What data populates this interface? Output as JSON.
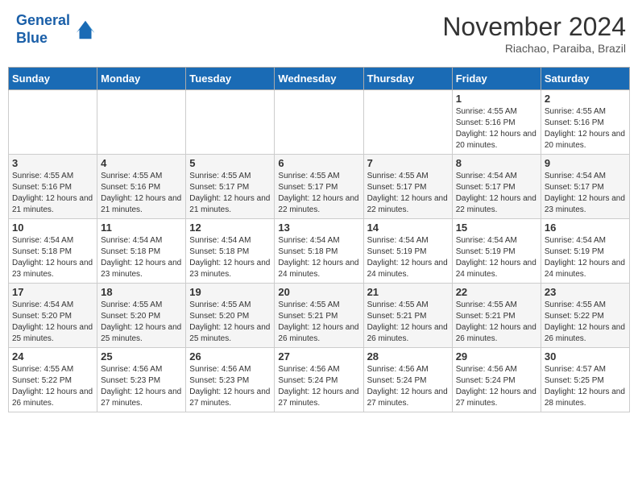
{
  "header": {
    "logo_line1": "General",
    "logo_line2": "Blue",
    "month_title": "November 2024",
    "subtitle": "Riachao, Paraiba, Brazil"
  },
  "days_of_week": [
    "Sunday",
    "Monday",
    "Tuesday",
    "Wednesday",
    "Thursday",
    "Friday",
    "Saturday"
  ],
  "weeks": [
    [
      {
        "day": "",
        "info": ""
      },
      {
        "day": "",
        "info": ""
      },
      {
        "day": "",
        "info": ""
      },
      {
        "day": "",
        "info": ""
      },
      {
        "day": "",
        "info": ""
      },
      {
        "day": "1",
        "info": "Sunrise: 4:55 AM\nSunset: 5:16 PM\nDaylight: 12 hours and 20 minutes."
      },
      {
        "day": "2",
        "info": "Sunrise: 4:55 AM\nSunset: 5:16 PM\nDaylight: 12 hours and 20 minutes."
      }
    ],
    [
      {
        "day": "3",
        "info": "Sunrise: 4:55 AM\nSunset: 5:16 PM\nDaylight: 12 hours and 21 minutes."
      },
      {
        "day": "4",
        "info": "Sunrise: 4:55 AM\nSunset: 5:16 PM\nDaylight: 12 hours and 21 minutes."
      },
      {
        "day": "5",
        "info": "Sunrise: 4:55 AM\nSunset: 5:17 PM\nDaylight: 12 hours and 21 minutes."
      },
      {
        "day": "6",
        "info": "Sunrise: 4:55 AM\nSunset: 5:17 PM\nDaylight: 12 hours and 22 minutes."
      },
      {
        "day": "7",
        "info": "Sunrise: 4:55 AM\nSunset: 5:17 PM\nDaylight: 12 hours and 22 minutes."
      },
      {
        "day": "8",
        "info": "Sunrise: 4:54 AM\nSunset: 5:17 PM\nDaylight: 12 hours and 22 minutes."
      },
      {
        "day": "9",
        "info": "Sunrise: 4:54 AM\nSunset: 5:17 PM\nDaylight: 12 hours and 23 minutes."
      }
    ],
    [
      {
        "day": "10",
        "info": "Sunrise: 4:54 AM\nSunset: 5:18 PM\nDaylight: 12 hours and 23 minutes."
      },
      {
        "day": "11",
        "info": "Sunrise: 4:54 AM\nSunset: 5:18 PM\nDaylight: 12 hours and 23 minutes."
      },
      {
        "day": "12",
        "info": "Sunrise: 4:54 AM\nSunset: 5:18 PM\nDaylight: 12 hours and 23 minutes."
      },
      {
        "day": "13",
        "info": "Sunrise: 4:54 AM\nSunset: 5:18 PM\nDaylight: 12 hours and 24 minutes."
      },
      {
        "day": "14",
        "info": "Sunrise: 4:54 AM\nSunset: 5:19 PM\nDaylight: 12 hours and 24 minutes."
      },
      {
        "day": "15",
        "info": "Sunrise: 4:54 AM\nSunset: 5:19 PM\nDaylight: 12 hours and 24 minutes."
      },
      {
        "day": "16",
        "info": "Sunrise: 4:54 AM\nSunset: 5:19 PM\nDaylight: 12 hours and 24 minutes."
      }
    ],
    [
      {
        "day": "17",
        "info": "Sunrise: 4:54 AM\nSunset: 5:20 PM\nDaylight: 12 hours and 25 minutes."
      },
      {
        "day": "18",
        "info": "Sunrise: 4:55 AM\nSunset: 5:20 PM\nDaylight: 12 hours and 25 minutes."
      },
      {
        "day": "19",
        "info": "Sunrise: 4:55 AM\nSunset: 5:20 PM\nDaylight: 12 hours and 25 minutes."
      },
      {
        "day": "20",
        "info": "Sunrise: 4:55 AM\nSunset: 5:21 PM\nDaylight: 12 hours and 26 minutes."
      },
      {
        "day": "21",
        "info": "Sunrise: 4:55 AM\nSunset: 5:21 PM\nDaylight: 12 hours and 26 minutes."
      },
      {
        "day": "22",
        "info": "Sunrise: 4:55 AM\nSunset: 5:21 PM\nDaylight: 12 hours and 26 minutes."
      },
      {
        "day": "23",
        "info": "Sunrise: 4:55 AM\nSunset: 5:22 PM\nDaylight: 12 hours and 26 minutes."
      }
    ],
    [
      {
        "day": "24",
        "info": "Sunrise: 4:55 AM\nSunset: 5:22 PM\nDaylight: 12 hours and 26 minutes."
      },
      {
        "day": "25",
        "info": "Sunrise: 4:56 AM\nSunset: 5:23 PM\nDaylight: 12 hours and 27 minutes."
      },
      {
        "day": "26",
        "info": "Sunrise: 4:56 AM\nSunset: 5:23 PM\nDaylight: 12 hours and 27 minutes."
      },
      {
        "day": "27",
        "info": "Sunrise: 4:56 AM\nSunset: 5:24 PM\nDaylight: 12 hours and 27 minutes."
      },
      {
        "day": "28",
        "info": "Sunrise: 4:56 AM\nSunset: 5:24 PM\nDaylight: 12 hours and 27 minutes."
      },
      {
        "day": "29",
        "info": "Sunrise: 4:56 AM\nSunset: 5:24 PM\nDaylight: 12 hours and 27 minutes."
      },
      {
        "day": "30",
        "info": "Sunrise: 4:57 AM\nSunset: 5:25 PM\nDaylight: 12 hours and 28 minutes."
      }
    ]
  ]
}
